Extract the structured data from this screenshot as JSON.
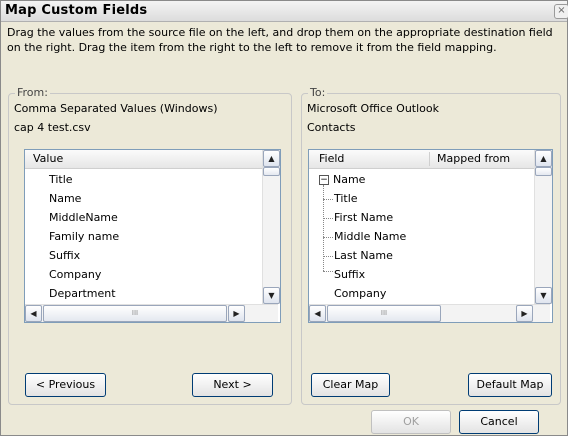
{
  "dialog": {
    "title": "Map Custom Fields",
    "instruction_line1": "Drag the values from the source file on the left, and drop them on the appropriate destination field",
    "instruction_line2": "on the right.  Drag the item from the right to the left to remove it from the field mapping."
  },
  "from": {
    "legend": "From:",
    "source_type": "Comma Separated Values (Windows)",
    "file_name": "cap 4 test.csv",
    "column_header": "Value",
    "items": [
      "Title",
      "Name",
      "MiddleName",
      "Family name",
      "Suffix",
      "Company",
      "Department"
    ],
    "prev_label": "< Previous",
    "next_label": "Next >"
  },
  "to": {
    "legend": "To:",
    "destination_app": "Microsoft Office Outlook",
    "destination_folder": "Contacts",
    "col_field": "Field",
    "col_mapped": "Mapped from",
    "expander_symbol": "−",
    "items": [
      "Name",
      "Title",
      "First Name",
      "Middle Name",
      "Last Name",
      "Suffix",
      "Company"
    ],
    "clear_label": "Clear Map",
    "default_label": "Default Map"
  },
  "footer": {
    "ok_label": "OK",
    "cancel_label": "Cancel"
  },
  "glyphs": {
    "close": "×",
    "up": "▲",
    "down": "▼",
    "left": "◀",
    "right": "▶",
    "grip": "III"
  }
}
